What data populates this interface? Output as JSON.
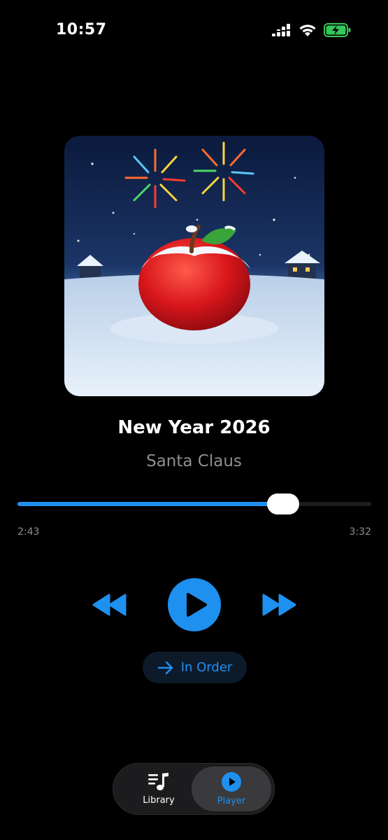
{
  "status_bar": {
    "time": "10:57",
    "icons": [
      "signal-icon",
      "wifi-icon",
      "battery-charging-icon"
    ]
  },
  "now_playing": {
    "artwork": "new-year-apple-artwork",
    "title": "New Year 2026",
    "artist": "Santa Claus",
    "progress_fraction": 0.75,
    "elapsed": "2:43",
    "duration": "3:32"
  },
  "controls": {
    "previous_icon": "rewind-icon",
    "play_icon": "play-icon",
    "next_icon": "fast-forward-icon"
  },
  "playback_mode": {
    "icon": "arrow-right-icon",
    "label": "In Order"
  },
  "tab_bar": {
    "tabs": [
      {
        "label": "Library",
        "icon": "library-music-icon",
        "selected": false
      },
      {
        "label": "Player",
        "icon": "player-play-circle-icon",
        "selected": true
      }
    ]
  },
  "colors": {
    "accent": "#1e90f0",
    "background": "#000000",
    "secondary_text": "#8e8e93"
  }
}
